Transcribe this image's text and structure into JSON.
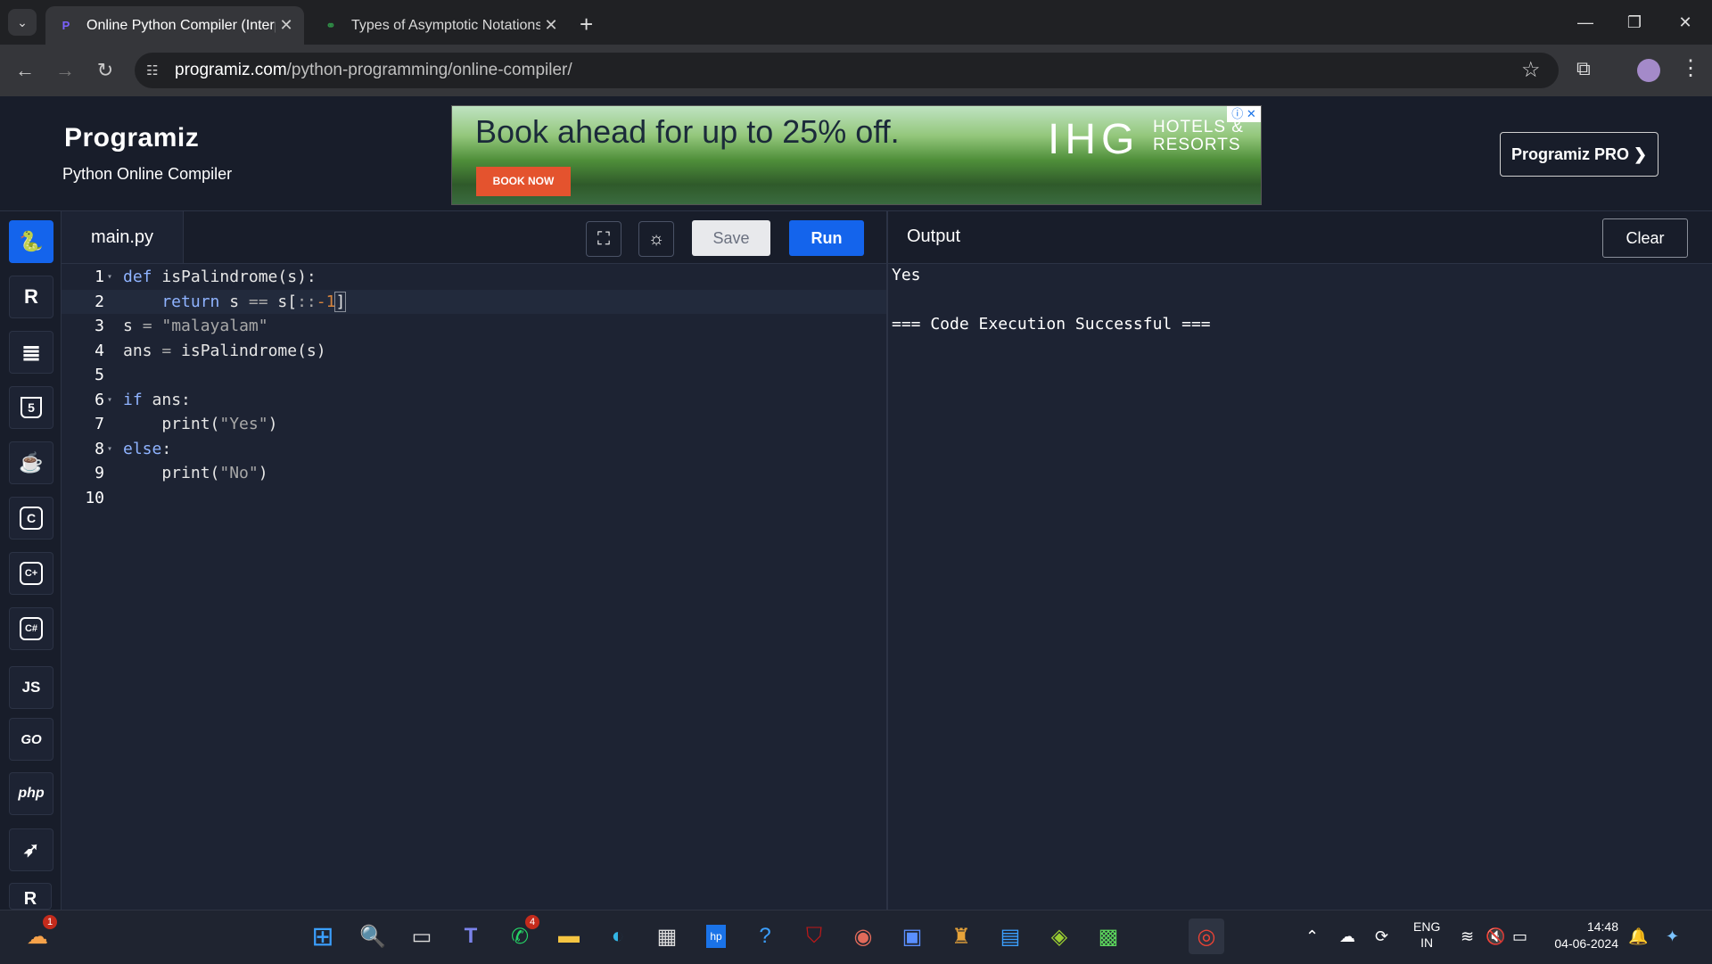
{
  "browser": {
    "tabs": [
      {
        "title": "Online Python Compiler (Interp",
        "active": true
      },
      {
        "title": "Types of Asymptotic Notations",
        "active": false
      }
    ],
    "url_host": "programiz.com",
    "url_path": "/python-programming/online-compiler/"
  },
  "site": {
    "logo": "Programiz",
    "subtitle": "Python Online Compiler",
    "pro_button": "Programiz PRO ❯"
  },
  "ad": {
    "headline": "Book ahead for up to 25% off.",
    "cta": "BOOK NOW",
    "brand": "IHG",
    "brand_sub": [
      "HOTELS &",
      "RESORTS"
    ]
  },
  "sidebar": {
    "languages": [
      {
        "name": "python",
        "glyph": "🐍",
        "active": true
      },
      {
        "name": "r",
        "glyph": "R"
      },
      {
        "name": "sql",
        "glyph": "≣"
      },
      {
        "name": "html",
        "glyph": "5"
      },
      {
        "name": "java",
        "glyph": "☕"
      },
      {
        "name": "c",
        "glyph": "C"
      },
      {
        "name": "cpp",
        "glyph": "C+"
      },
      {
        "name": "csharp",
        "glyph": "C#"
      },
      {
        "name": "javascript",
        "glyph": "JS"
      },
      {
        "name": "go",
        "glyph": "GO"
      },
      {
        "name": "php",
        "glyph": "php"
      },
      {
        "name": "swift",
        "glyph": "➶"
      },
      {
        "name": "rust",
        "glyph": "R"
      }
    ]
  },
  "editor": {
    "filename": "main.py",
    "save_label": "Save",
    "run_label": "Run",
    "lines": [
      {
        "n": "1",
        "fold": true
      },
      {
        "n": "2"
      },
      {
        "n": "3"
      },
      {
        "n": "4"
      },
      {
        "n": "5"
      },
      {
        "n": "6",
        "fold": true
      },
      {
        "n": "7"
      },
      {
        "n": "8",
        "fold": true
      },
      {
        "n": "9"
      },
      {
        "n": "10"
      }
    ],
    "code": {
      "l1_kw": "def",
      "l1_rest": " isPalindrome(s):",
      "l2_kw": "    return",
      "l2_a": " s ",
      "l2_op": "==",
      "l2_b": " s[",
      "l2_c": "::",
      "l2_num": "-1",
      "l2_d": "]",
      "l3_a": "s ",
      "l3_op": "=",
      "l3_str": " \"malayalam\"",
      "l4_a": "ans ",
      "l4_op": "=",
      "l4_b": " isPalindrome(s)",
      "l6_kw": "if",
      "l6_b": " ans:",
      "l7_a": "    print(",
      "l7_str": "\"Yes\"",
      "l7_b": ")",
      "l8_kw": "else",
      "l8_b": ":",
      "l9_a": "    print(",
      "l9_str": "\"No\"",
      "l9_b": ")"
    }
  },
  "output": {
    "title": "Output",
    "clear_label": "Clear",
    "lines": [
      "Yes",
      "",
      "=== Code Execution Successful ==="
    ]
  },
  "taskbar": {
    "whatsapp_badge": "4",
    "widgets_badge": "1",
    "language": [
      "ENG",
      "IN"
    ],
    "time": "14:48",
    "date": "04-06-2024"
  }
}
